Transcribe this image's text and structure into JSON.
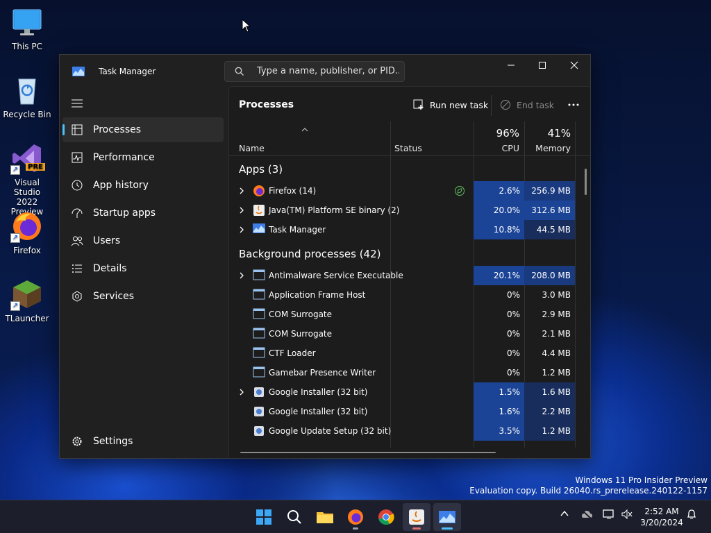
{
  "desktop": {
    "icons": [
      {
        "label": "This PC",
        "icon": "monitor-icon"
      },
      {
        "label": "Recycle Bin",
        "icon": "recycle-bin-icon"
      },
      {
        "label": "Visual Studio 2022 Preview",
        "label_line1": "Visual Studio",
        "label_line2": "2022 Preview",
        "badge": "PRE",
        "icon": "visual-studio-icon"
      },
      {
        "label": "Firefox",
        "icon": "firefox-icon"
      },
      {
        "label": "TLauncher",
        "icon": "tlauncher-icon"
      }
    ]
  },
  "task_manager": {
    "title": "Task Manager",
    "search_placeholder": "Type a name, publisher, or PID...",
    "nav": [
      {
        "label": "Processes",
        "icon": "processes-icon",
        "active": true
      },
      {
        "label": "Performance",
        "icon": "performance-icon"
      },
      {
        "label": "App history",
        "icon": "history-icon"
      },
      {
        "label": "Startup apps",
        "icon": "startup-icon"
      },
      {
        "label": "Users",
        "icon": "users-icon"
      },
      {
        "label": "Details",
        "icon": "details-icon"
      },
      {
        "label": "Services",
        "icon": "services-icon"
      }
    ],
    "settings_label": "Settings",
    "page_title": "Processes",
    "run_new_task": "Run new task",
    "end_task": "End task",
    "columns": {
      "name": "Name",
      "status": "Status",
      "cpu_pct": "96%",
      "cpu": "CPU",
      "mem_pct": "41%",
      "memory": "Memory"
    },
    "apps_group": "Apps (3)",
    "background_group": "Background processes (42)",
    "apps": [
      {
        "name": "Firefox (14)",
        "cpu": "2.6%",
        "mem": "256.9 MB",
        "expand": true,
        "eco": true,
        "icon": "firefox-icon"
      },
      {
        "name": "Java(TM) Platform SE binary (2)",
        "cpu": "20.0%",
        "mem": "312.6 MB",
        "expand": true,
        "icon": "java-icon"
      },
      {
        "name": "Task Manager",
        "cpu": "10.8%",
        "mem": "44.5 MB",
        "expand": true,
        "icon": "task-manager-icon"
      }
    ],
    "background": [
      {
        "name": "Antimalware Service Executable",
        "cpu": "20.1%",
        "mem": "208.0 MB",
        "expand": true,
        "icon": "process-icon"
      },
      {
        "name": "Application Frame Host",
        "cpu": "0%",
        "mem": "3.0 MB",
        "icon": "process-icon"
      },
      {
        "name": "COM Surrogate",
        "cpu": "0%",
        "mem": "2.9 MB",
        "icon": "process-icon"
      },
      {
        "name": "COM Surrogate",
        "cpu": "0%",
        "mem": "2.1 MB",
        "icon": "process-icon"
      },
      {
        "name": "CTF Loader",
        "cpu": "0%",
        "mem": "4.4 MB",
        "icon": "process-icon"
      },
      {
        "name": "Gamebar Presence Writer",
        "cpu": "0%",
        "mem": "1.2 MB",
        "icon": "process-icon"
      },
      {
        "name": "Google Installer (32 bit)",
        "cpu": "1.5%",
        "mem": "1.6 MB",
        "expand": true,
        "icon": "google-installer-icon"
      },
      {
        "name": "Google Installer (32 bit)",
        "cpu": "1.6%",
        "mem": "2.2 MB",
        "icon": "google-installer-icon"
      },
      {
        "name": "Google Update Setup (32 bit)",
        "cpu": "3.5%",
        "mem": "1.2 MB",
        "icon": "google-installer-icon"
      }
    ]
  },
  "watermark": {
    "line1": "Windows 11 Pro Insider Preview",
    "line2": "Evaluation copy. Build 26040.rs_prerelease.240122-1157"
  },
  "taskbar": {
    "items": [
      "start-icon",
      "search-icon",
      "file-explorer-icon",
      "firefox-icon",
      "chrome-icon",
      "java-icon",
      "task-manager-icon"
    ],
    "time": "2:52 AM",
    "date": "3/20/2024"
  },
  "colors": {
    "accent": "#4cc2ff",
    "heat_high": "#1b4497",
    "heat_mid": "#1a3a80",
    "window_bg": "#202020"
  }
}
